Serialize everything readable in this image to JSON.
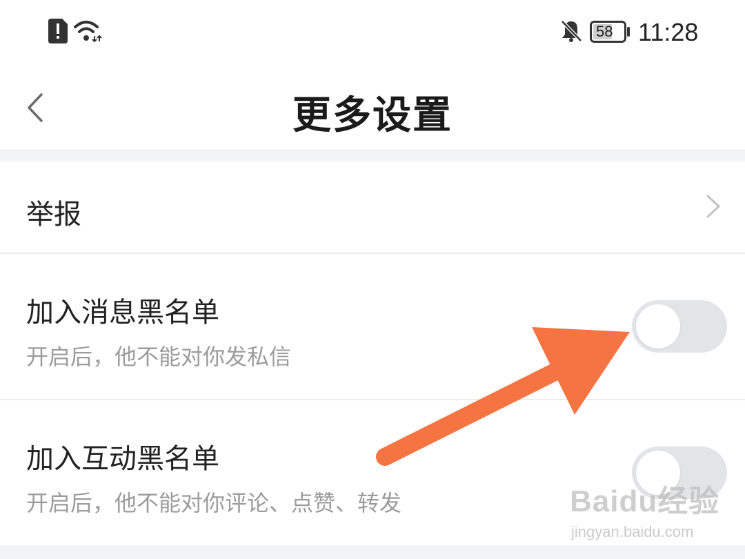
{
  "status_bar": {
    "time": "11:28",
    "battery": "58",
    "icons": [
      "alert-sim-icon",
      "wifi-icon",
      "bell-off-icon",
      "battery-icon"
    ]
  },
  "header": {
    "title": "更多设置",
    "back_icon": "chevron-left-icon"
  },
  "settings": {
    "report": {
      "label": "举报",
      "icon": "chevron-right-icon"
    },
    "message_blacklist": {
      "label": "加入消息黑名单",
      "description": "开启后，他不能对你发私信",
      "enabled": false
    },
    "interaction_blacklist": {
      "label": "加入互动黑名单",
      "description": "开启后，他不能对你评论、点赞、转发",
      "enabled": false
    }
  },
  "annotation": {
    "color": "#f57442",
    "target": "message-blacklist-toggle"
  },
  "watermark": {
    "logo": "Baidu经验",
    "url": "jingyan.baidu.com"
  },
  "colors": {
    "toggle_off": "#e3e4e6",
    "divider": "#ececec",
    "secondary_text": "#9c9c9c"
  }
}
